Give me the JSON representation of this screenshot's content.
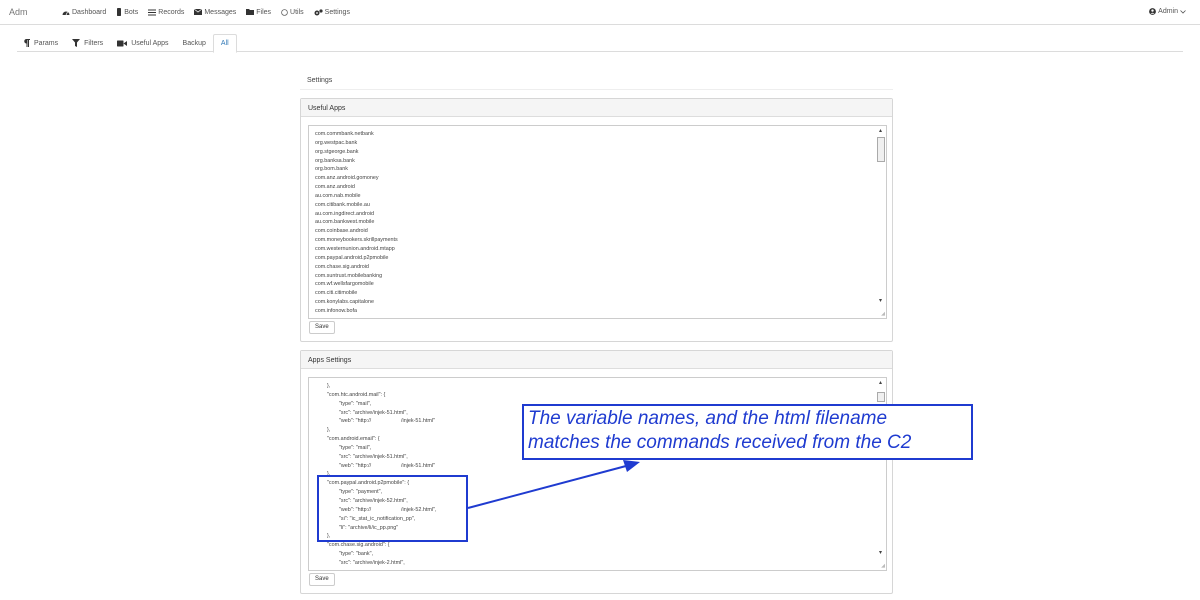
{
  "brand": "Adm",
  "nav": [
    {
      "label": "Dashboard",
      "icon": "tachometer-icon"
    },
    {
      "label": "Bots",
      "icon": "mobile-icon"
    },
    {
      "label": "Records",
      "icon": "list-icon"
    },
    {
      "label": "Messages",
      "icon": "envelope-icon"
    },
    {
      "label": "Files",
      "icon": "folder-icon"
    },
    {
      "label": "Utils",
      "icon": "circle-icon"
    },
    {
      "label": "Settings",
      "icon": "cogs-icon"
    }
  ],
  "user": {
    "label": "Admin",
    "icon": "user-icon"
  },
  "tabs": [
    {
      "label": "Params",
      "icon": "paragraph-icon"
    },
    {
      "label": "Filters",
      "icon": "filter-icon"
    },
    {
      "label": "Useful Apps",
      "icon": "video-icon"
    },
    {
      "label": "Backup"
    },
    {
      "label": "All",
      "active": true
    }
  ],
  "page": {
    "title": "Settings"
  },
  "useful_apps": {
    "heading": "Useful Apps",
    "save_label": "Save",
    "lines": [
      "com.commbank.netbank",
      "org.westpac.bank",
      "org.stgeorge.bank",
      "org.banksa.bank",
      "org.bom.bank",
      "com.anz.android.gomoney",
      "com.anz.android",
      "au.com.nab.mobile",
      "com.citibank.mobile.au",
      "au.com.ingdirect.android",
      "au.com.bankwest.mobile",
      "com.coinbase.android",
      "com.moneybookers.skrillpayments",
      "com.westernunion.android.mtapp",
      "com.paypal.android.p2pmobile",
      "com.chase.sig.android",
      "com.suntrust.mobilebanking",
      "com.wf.wellsfargomobile",
      "com.citi.citimobile",
      "com.konylabs.capitalone",
      "com.infonow.bofa"
    ]
  },
  "apps_settings": {
    "heading": "Apps Settings",
    "save_label": "Save",
    "lines": [
      "        },",
      "        \"com.htc.android.mail\": {",
      "                \"type\": \"mail\",",
      "                \"src\": \"archive/injek-51.html\",",
      "                \"web\": \"http://                    /injek-51.html\"",
      "        },",
      "        \"com.android.email\": {",
      "                \"type\": \"mail\",",
      "                \"src\": \"archive/injek-51.html\",",
      "                \"web\": \"http://                    /injek-51.html\"",
      "        },",
      "        \"com.paypal.android.p2pmobile\": {",
      "                \"type\": \"payment\",",
      "                \"src\": \"archive/injek-52.html\",",
      "                \"web\": \"http://                    /injek-52.html\",",
      "                \"si\": \"ic_stat_ic_notification_pp\",",
      "                \"li\": \"archive/li/ic_pp.png\"",
      "        },",
      "        \"com.chase.sig.android\": {",
      "                \"type\": \"bank\",",
      "                \"src\": \"archive/injek-2.html\","
    ]
  },
  "annotation": {
    "line1": "The variable names, and the html filename",
    "line2": "matches the commands received from the C2",
    "color": "#1f3bd0"
  }
}
